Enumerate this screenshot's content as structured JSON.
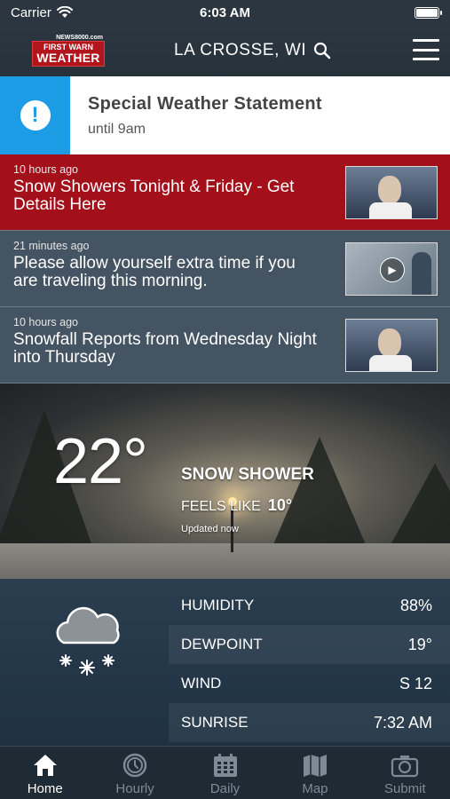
{
  "status": {
    "carrier": "Carrier",
    "time": "6:03 AM",
    "battery_level": 1.0
  },
  "header": {
    "logo": {
      "top": "NEWS8000.com",
      "line1": "FIRST WARN",
      "line2": "WEATHER"
    },
    "location": "LA CROSSE, WI"
  },
  "alert": {
    "icon": "!",
    "title": "Special Weather Statement",
    "subtitle": "until 9am",
    "color": "#1b9ce5"
  },
  "news": [
    {
      "time": "10 hours ago",
      "headline": "Snow Showers Tonight & Friday - Get Details Here"
    },
    {
      "time": "21 minutes ago",
      "headline": "Please allow yourself extra time if you are traveling this morning."
    },
    {
      "time": "10 hours ago",
      "headline": "Snowfall Reports from Wednesday Night into Thursday"
    }
  ],
  "current": {
    "temp": "22°",
    "condition": "SNOW SHOWER",
    "feels_label": "FEELS LIKE",
    "feels_value": "10°",
    "updated": "Updated now"
  },
  "details": [
    {
      "label": "HUMIDITY",
      "value": "88%"
    },
    {
      "label": "DEWPOINT",
      "value": "19°"
    },
    {
      "label": "WIND",
      "value": "S 12"
    },
    {
      "label": "SUNRISE",
      "value": "7:32 AM"
    }
  ],
  "tabs": [
    {
      "label": "Home",
      "icon": "home-icon",
      "active": true
    },
    {
      "label": "Hourly",
      "icon": "clock-icon",
      "active": false
    },
    {
      "label": "Daily",
      "icon": "calendar-icon",
      "active": false
    },
    {
      "label": "Map",
      "icon": "map-icon",
      "active": false
    },
    {
      "label": "Submit",
      "icon": "camera-icon",
      "active": false
    }
  ],
  "colors": {
    "brand_red": "#b3151d",
    "news_highlight": "#a3101a",
    "tab_inactive": "#7e8b96"
  }
}
